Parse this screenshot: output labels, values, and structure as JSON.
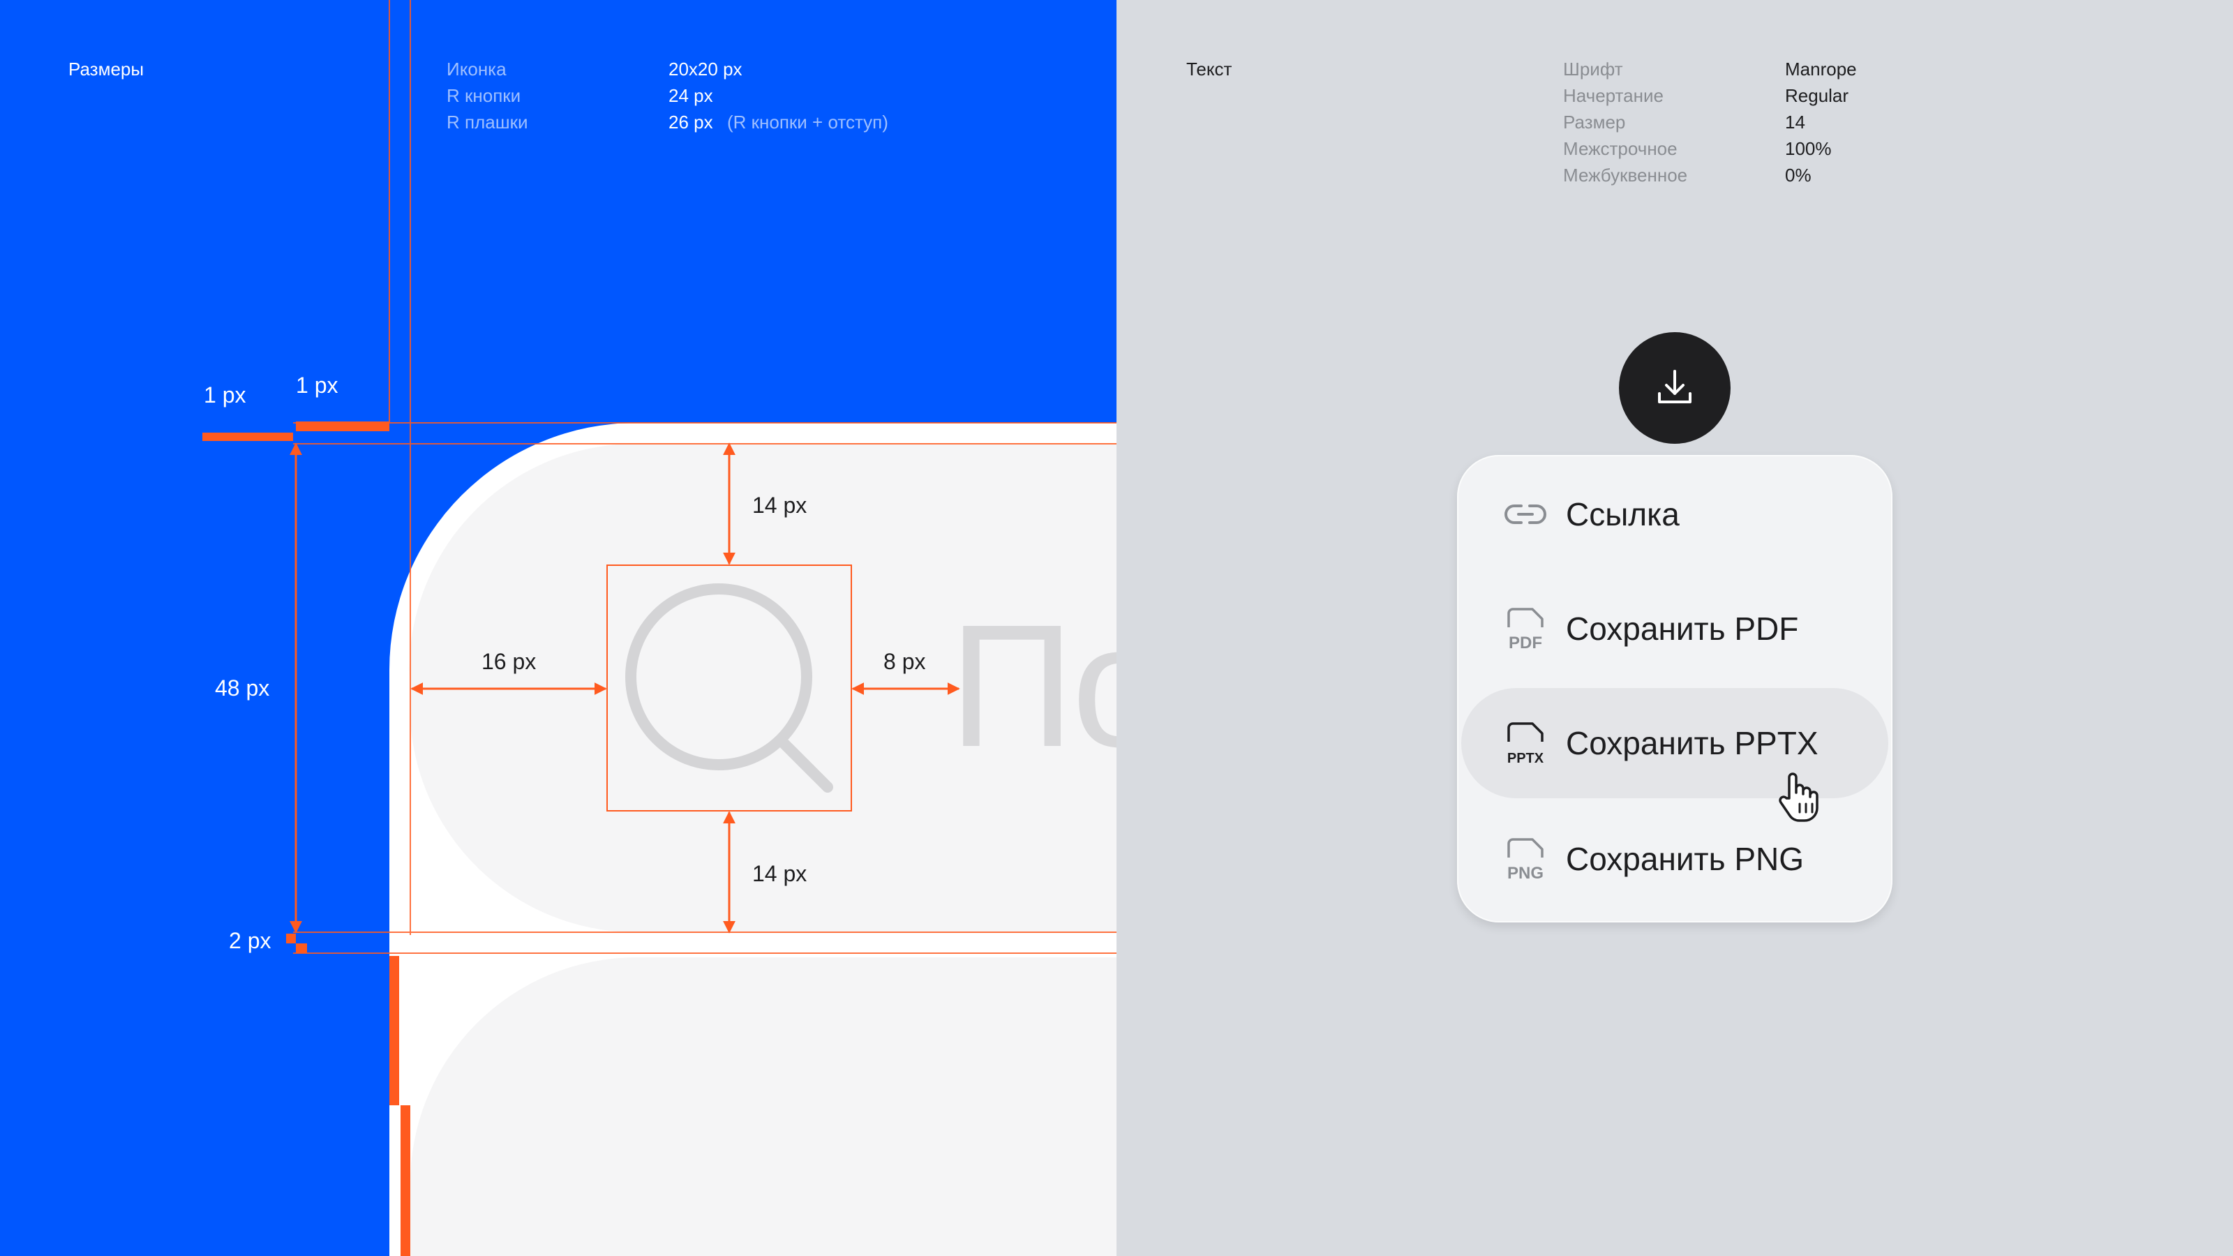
{
  "sizes": {
    "title": "Размеры",
    "rows": [
      {
        "key": "Иконка",
        "value": "20x20 px",
        "note": ""
      },
      {
        "key": "R кнопки",
        "value": "24 px",
        "note": ""
      },
      {
        "key": "R плашки",
        "value": "26 px",
        "note": "(R кнопки + отступ)"
      }
    ],
    "dimensions": {
      "outer_stroke": "1 px",
      "inner_stroke": "1 px",
      "height": "48 px",
      "gap": "2 px",
      "padding_top": "14 px",
      "padding_bottom": "14 px",
      "padding_left": "16 px",
      "icon_gap": "8 px"
    },
    "field_placeholder_fragment": "По"
  },
  "text": {
    "title": "Текст",
    "rows": [
      {
        "key": "Шрифт",
        "value": "Manrope"
      },
      {
        "key": "Начертание",
        "value": "Regular"
      },
      {
        "key": "Размер",
        "value": "14"
      },
      {
        "key": "Межстрочное",
        "value": "100%"
      },
      {
        "key": "Межбуквенное",
        "value": "0%"
      }
    ]
  },
  "menu": {
    "trigger_icon": "download-icon",
    "items": [
      {
        "label": "Ссылка",
        "icon": "link-icon",
        "icon_text": "",
        "hover": false
      },
      {
        "label": "Сохранить PDF",
        "icon": "pdf-file-icon",
        "icon_text": "PDF",
        "hover": false
      },
      {
        "label": "Сохранить PPTX",
        "icon": "pptx-file-icon",
        "icon_text": "PPTX",
        "hover": true
      },
      {
        "label": "Сохранить PNG",
        "icon": "png-file-icon",
        "icon_text": "PNG",
        "hover": false
      }
    ]
  },
  "colors": {
    "accent_blue": "#0057FF",
    "measure_orange": "#FF5A1F",
    "panel_grey": "#D8DBE0",
    "button_dark": "#1F1F21"
  }
}
